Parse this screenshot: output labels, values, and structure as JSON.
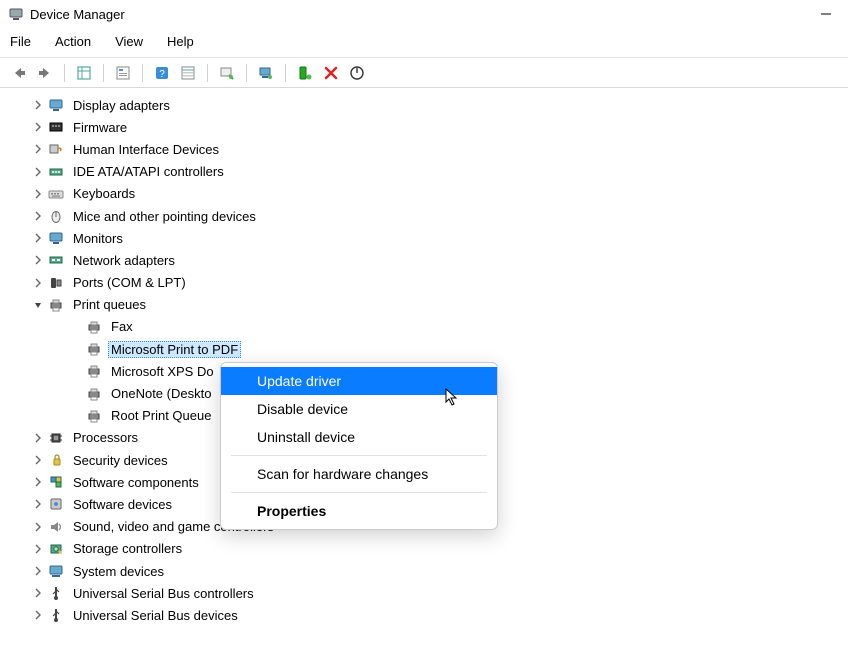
{
  "window": {
    "title": "Device Manager"
  },
  "menubar": [
    "File",
    "Action",
    "View",
    "Help"
  ],
  "tree": [
    {
      "label": "Display adapters",
      "icon": "monitor-icon",
      "level": 0,
      "expand": "closed"
    },
    {
      "label": "Firmware",
      "icon": "firmware-icon",
      "level": 0,
      "expand": "closed"
    },
    {
      "label": "Human Interface Devices",
      "icon": "hid-icon",
      "level": 0,
      "expand": "closed"
    },
    {
      "label": "IDE ATA/ATAPI controllers",
      "icon": "ide-icon",
      "level": 0,
      "expand": "closed"
    },
    {
      "label": "Keyboards",
      "icon": "keyboard-icon",
      "level": 0,
      "expand": "closed"
    },
    {
      "label": "Mice and other pointing devices",
      "icon": "mouse-icon",
      "level": 0,
      "expand": "closed"
    },
    {
      "label": "Monitors",
      "icon": "monitor-icon",
      "level": 0,
      "expand": "closed"
    },
    {
      "label": "Network adapters",
      "icon": "network-icon",
      "level": 0,
      "expand": "closed"
    },
    {
      "label": "Ports (COM & LPT)",
      "icon": "port-icon",
      "level": 0,
      "expand": "closed"
    },
    {
      "label": "Print queues",
      "icon": "printer-icon",
      "level": 0,
      "expand": "open"
    },
    {
      "label": "Fax",
      "icon": "printer-icon",
      "level": 1,
      "expand": "none"
    },
    {
      "label": "Microsoft Print to PDF",
      "icon": "printer-icon",
      "level": 1,
      "expand": "none",
      "selected": true
    },
    {
      "label": "Microsoft XPS Document Writer",
      "icon": "printer-icon",
      "level": 1,
      "expand": "none",
      "truncated": "Microsoft XPS Do"
    },
    {
      "label": "OneNote (Desktop)",
      "icon": "printer-icon",
      "level": 1,
      "expand": "none",
      "truncated": "OneNote (Deskto"
    },
    {
      "label": "Root Print Queue",
      "icon": "printer-icon",
      "level": 1,
      "expand": "none"
    },
    {
      "label": "Processors",
      "icon": "processor-icon",
      "level": 0,
      "expand": "closed"
    },
    {
      "label": "Security devices",
      "icon": "security-icon",
      "level": 0,
      "expand": "closed"
    },
    {
      "label": "Software components",
      "icon": "software-comp-icon",
      "level": 0,
      "expand": "closed"
    },
    {
      "label": "Software devices",
      "icon": "software-dev-icon",
      "level": 0,
      "expand": "closed"
    },
    {
      "label": "Sound, video and game controllers",
      "icon": "sound-icon",
      "level": 0,
      "expand": "closed"
    },
    {
      "label": "Storage controllers",
      "icon": "storage-icon",
      "level": 0,
      "expand": "closed"
    },
    {
      "label": "System devices",
      "icon": "system-icon",
      "level": 0,
      "expand": "closed"
    },
    {
      "label": "Universal Serial Bus controllers",
      "icon": "usb-icon",
      "level": 0,
      "expand": "closed"
    },
    {
      "label": "Universal Serial Bus devices",
      "icon": "usb-icon",
      "level": 0,
      "expand": "closed"
    }
  ],
  "context_menu": {
    "items": [
      {
        "label": "Update driver",
        "highlight": true
      },
      {
        "label": "Disable device"
      },
      {
        "label": "Uninstall device"
      },
      {
        "sep": true
      },
      {
        "label": "Scan for hardware changes"
      },
      {
        "sep": true
      },
      {
        "label": "Properties",
        "bold": true
      }
    ]
  },
  "toolbar_icons": [
    "back-icon",
    "forward-icon",
    "sep",
    "show-hidden-icon",
    "sep",
    "properties-icon",
    "sep",
    "help-icon",
    "details-icon",
    "sep",
    "update-driver-icon",
    "sep",
    "scan-hardware-icon",
    "sep",
    "uninstall-icon",
    "disable-icon",
    "enable-icon"
  ]
}
